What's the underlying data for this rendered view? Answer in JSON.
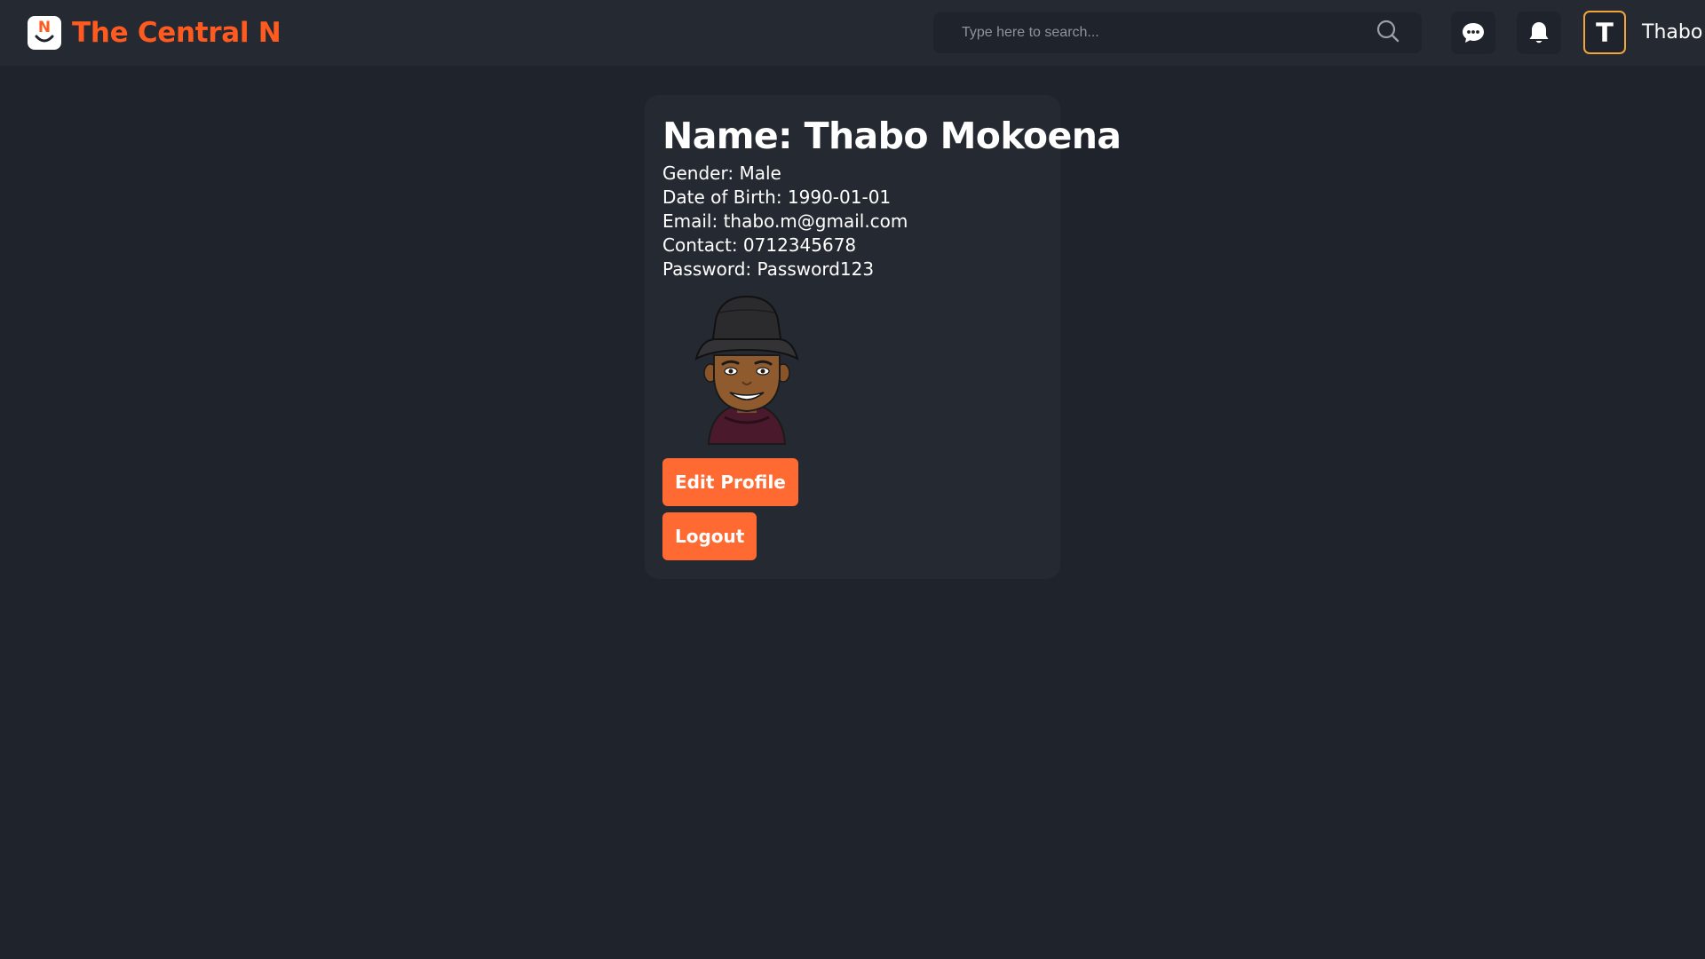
{
  "header": {
    "logo_letter": "N",
    "brand_name": "The Central N",
    "search": {
      "placeholder": "Type here to search...",
      "icon": "search-icon"
    },
    "icons": [
      "chat-icon",
      "bell-icon"
    ],
    "avatar_initial": "T",
    "username": "Thabo"
  },
  "profile": {
    "title": "Name: Thabo Mokoena",
    "gender": "Gender: Male",
    "dob": "Date of Birth: 1990-01-01",
    "email": "Email: thabo.m@gmail.com",
    "contact": "Contact: 0712345678",
    "password": "Password: Password123",
    "edit_label": "Edit Profile",
    "logout_label": "Logout"
  },
  "colors": {
    "accent": "#ff6a33",
    "brand": "#ff5a1f",
    "background": "#1f232b",
    "surface": "#252a32",
    "avatar_border": "#f2a33a"
  }
}
